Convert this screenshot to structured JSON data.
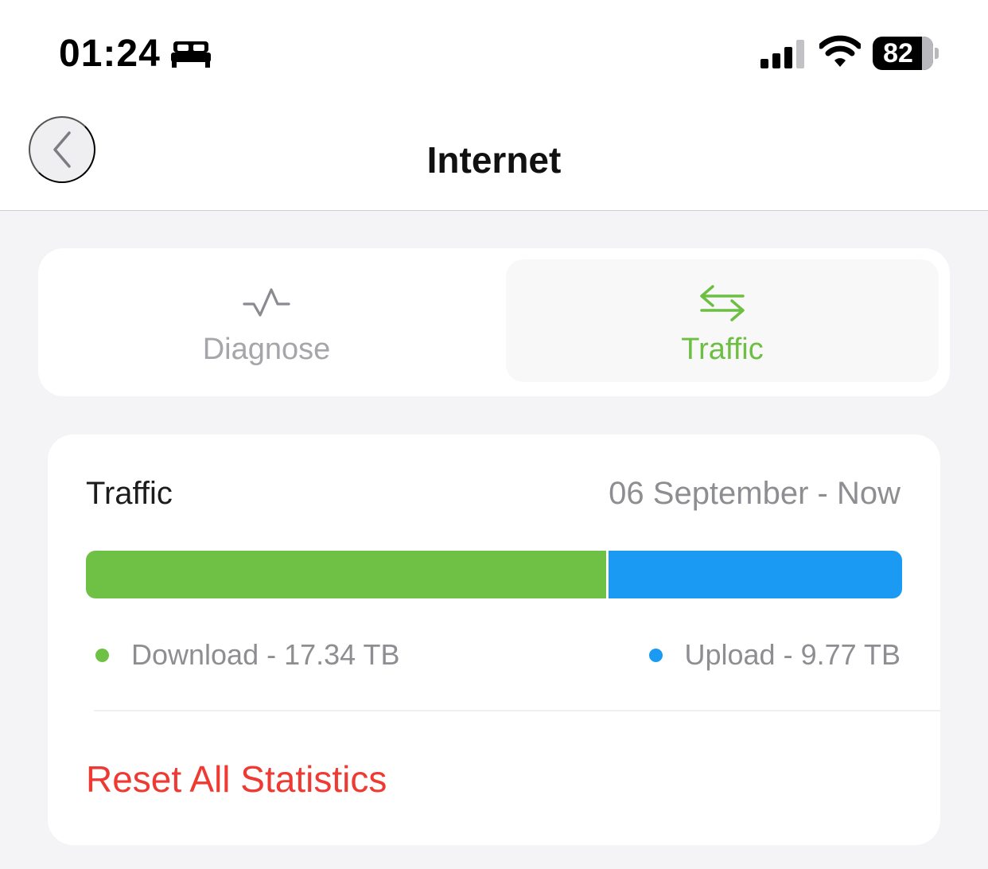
{
  "status_bar": {
    "time": "01:24",
    "focus_icon": "bed-icon",
    "battery_level": "82",
    "battery_fraction": 0.82
  },
  "nav": {
    "title": "Internet",
    "back_icon": "chevron-left-icon"
  },
  "segments": [
    {
      "label": "Diagnose",
      "icon": "pulse-icon",
      "selected": false
    },
    {
      "label": "Traffic",
      "icon": "arrows-swap-icon",
      "selected": true
    }
  ],
  "traffic": {
    "title": "Traffic",
    "range": "06 September - Now",
    "download_label": "Download - 17.34 TB",
    "upload_label": "Upload - 9.77 TB",
    "download_tb": 17.34,
    "upload_tb": 9.77,
    "reset_label": "Reset All Statistics"
  },
  "colors": {
    "accent_green": "#6ec145",
    "upload_blue": "#1a9af2",
    "destructive_red": "#ee3a32",
    "muted_gray": "#8e8e92"
  }
}
